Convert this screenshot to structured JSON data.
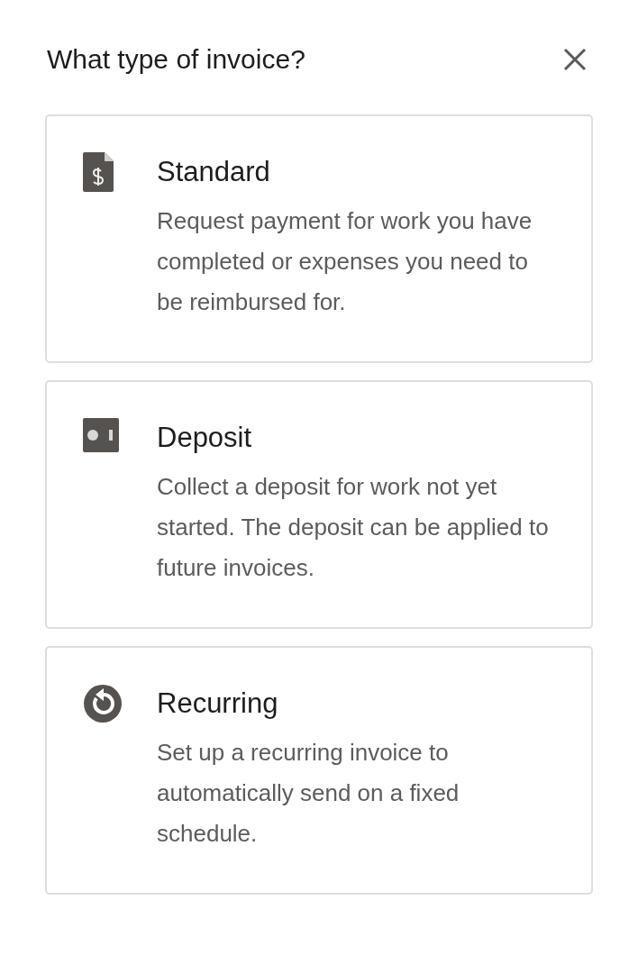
{
  "dialog": {
    "title": "What type of invoice?"
  },
  "options": [
    {
      "kind": "document",
      "title": "Standard",
      "description": "Request payment for work you have completed or expenses you need to be reimbursed for."
    },
    {
      "kind": "deposit",
      "title": "Deposit",
      "description": "Collect a deposit for work not yet started. The deposit can be applied to future invoices."
    },
    {
      "kind": "recurring",
      "title": "Recurring",
      "description": "Set up a recurring invoice to automatically send on a fixed schedule."
    }
  ]
}
